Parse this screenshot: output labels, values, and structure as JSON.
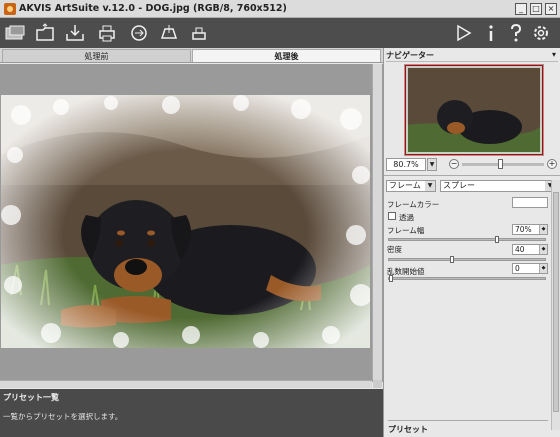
{
  "window": {
    "title": "AKVIS ArtSuite v.12.0 - DOG.jpg (RGB/8, 760x512)",
    "app_icon": "akvis-logo-icon",
    "controls": [
      "minimize",
      "maximize",
      "close"
    ],
    "control_glyphs": [
      "_",
      "□",
      "×"
    ]
  },
  "toolbar": {
    "left_buttons": [
      "monitor-icon",
      "folder-open-icon",
      "save-icon",
      "print-icon",
      "share-icon",
      "batch-icon",
      "plugin-icon"
    ],
    "right_buttons": [
      "play-icon",
      "info-icon",
      "help-icon",
      "settings-icon"
    ]
  },
  "tabs": [
    {
      "label": "処理前",
      "active": false
    },
    {
      "label": "処理後",
      "active": true
    }
  ],
  "presets_panel": {
    "header": "プリセット一覧",
    "hint": "一覧からプリセットを選択します。"
  },
  "navigator": {
    "header": "ナビゲーター",
    "zoom": "80.7%",
    "zoom_minus": "−",
    "zoom_plus": "+"
  },
  "settings": {
    "category": "フレーム",
    "style": "スプレー",
    "frame_color_label": "フレームカラー",
    "transparent_label": "透過",
    "frame_width_label": "フレーム幅",
    "frame_width_value": "70%",
    "frame_width_fraction": 0.7,
    "density_label": "密度",
    "density_value": "40",
    "density_fraction": 0.4,
    "random_seed_label": "乱数開始値",
    "random_seed_value": "0",
    "random_seed_fraction": 0.0
  },
  "bottom_presets": {
    "header": "プリセット"
  }
}
